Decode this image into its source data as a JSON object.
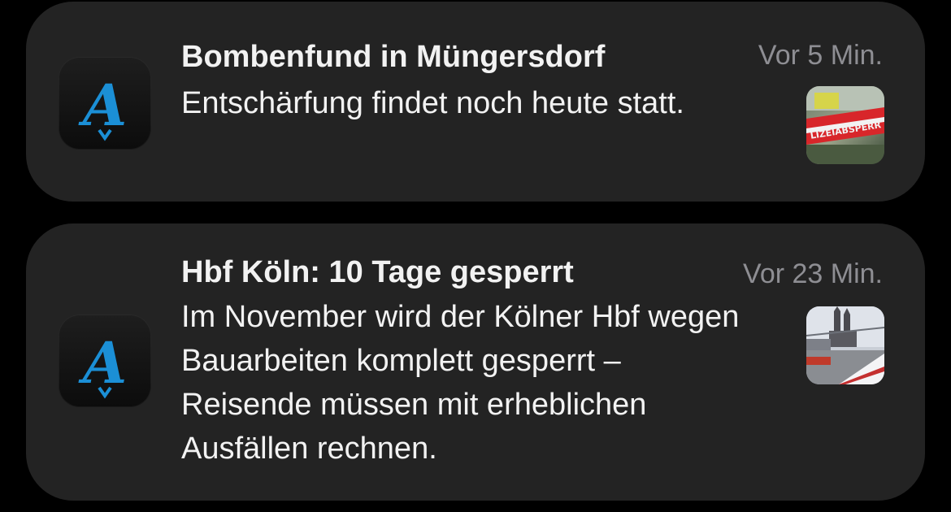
{
  "notifications": [
    {
      "app_icon": "newspaper-fraktur-A-icon",
      "title": "Bombenfund in Müngersdorf",
      "time": "Vor 5 Min.",
      "body": "Entschärfung findet noch heute statt.",
      "thumbnail_text": "LIZEIABSPERR"
    },
    {
      "app_icon": "newspaper-fraktur-A-icon",
      "title": "Hbf Köln: 10 Tage gesperrt",
      "time": "Vor 23 Min.",
      "body": "Im November wird der Kölner Hbf wegen Bauarbeiten komplett gesperrt – Reisende müssen mit erheblichen Ausfällen rechnen."
    }
  ],
  "colors": {
    "background": "#000000",
    "card": "#232323",
    "text": "#f2f2f2",
    "secondary": "#8e8e93",
    "accent": "#1b8fd6"
  }
}
